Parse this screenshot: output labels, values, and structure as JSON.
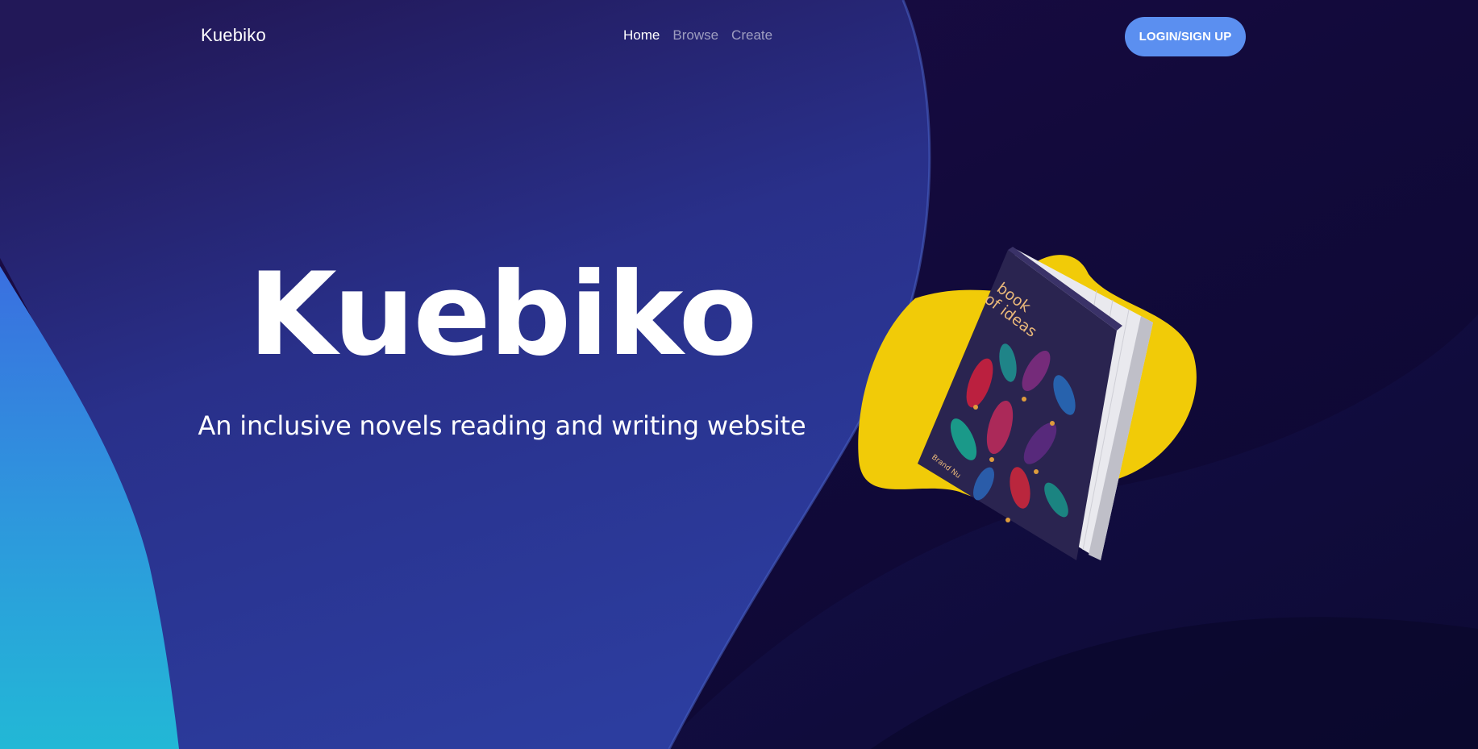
{
  "nav": {
    "brand": "Kuebiko",
    "links": [
      {
        "label": "Home",
        "active": true
      },
      {
        "label": "Browse",
        "active": false
      },
      {
        "label": "Create",
        "active": false
      }
    ],
    "login_label": "LOGIN/SIGN UP"
  },
  "hero": {
    "title": "Kuebiko",
    "subtitle": "An inclusive novels reading and writing website"
  },
  "book": {
    "cover_title_line1": "book",
    "cover_title_line2": "of ideas",
    "cover_author": "Brand Nu"
  },
  "colors": {
    "background": "#0e0833",
    "hero_blob": "#2b3a96",
    "accent_blue": "#5b8ff0",
    "cyan_wave": "#29b6d9",
    "book_blob": "#f1cb08",
    "book_cover": "#2a2450"
  }
}
